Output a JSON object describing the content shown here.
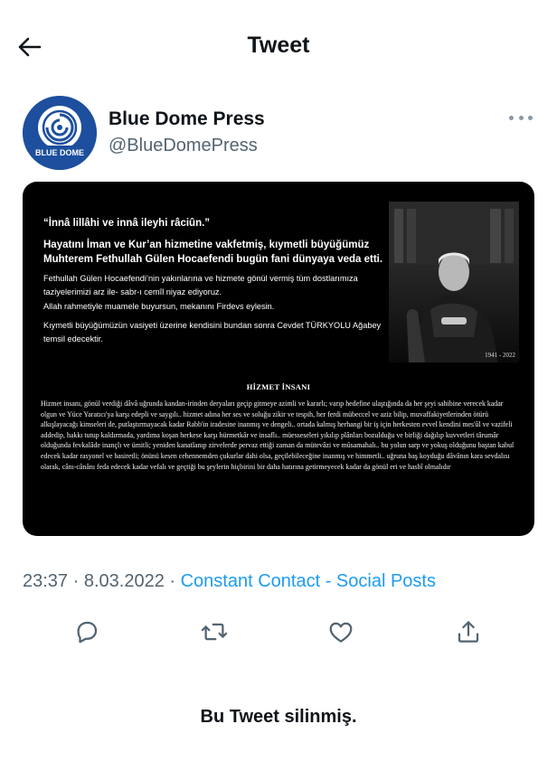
{
  "header": {
    "title": "Tweet"
  },
  "author": {
    "name": "Blue Dome Press",
    "handle": "@BlueDomePress",
    "avatar_text": "BLUE DOME",
    "avatar_color": "#1d4f9e"
  },
  "media": {
    "quote": "“İnnâ lillâhi ve innâ ileyhi râciûn.”",
    "p1": "Hayatını İman ve Kur’an hizmetine vakfetmiş, kıymetli büyüğümüz Muhterem Fethullah Gülen Hocaefendi bugün fani dünyaya veda etti.",
    "p2": "Fethullah Gülen Hocaefendi’nin yakınlarına ve hizmete gönül vermiş tüm dostlarımıza taziyelerimizi arz ile- sabr-ı cemîl niyaz ediyoruz.",
    "p3": "Allah rahmetiyle muamele buyursun, mekanını Firdevs eylesin.",
    "p4": "Kıymetli büyüğümüzün vasiyeti üzerine kendisini bundan sonra Cevdet TÜRKYOLU Ağabey temsil edecektir.",
    "years": "1941 - 2022",
    "heading": "HİZMET İNSANI",
    "body": "Hizmet insanı, gönül verdiği dâvâ uğrunda kandan-irinden deryaları geçip gitmeye azimli ve kararlı; varıp hedefine ulaştığında da her şeyi sahibine verecek kadar olgun ve Yüce Yaratıcı'ya karşı edepli ve saygılı.. hizmet adına her ses ve soluğu zikir ve tespih, her ferdi mübeccel ve aziz bilip, muvaffakiyetlerinden ötürü alkışlayacağı kimseleri de, putlaştırmayacak kadar Rabb'in iradesine inanmış ve dengeli.. ortada kalmış herhangi bir iş için herkesten evvel kendini mes'ûl ve vazifeli addedip, hakkı tutup kaldırmada, yardıma koşan herkese karşı hürmetkâr ve insaflı.. müesseseleri yıkılıp plânları bozulduğu ve birliği dağılıp kuvvetleri târumâr olduğunda fevkalâde inançlı ve ümitli; yeniden kanatlanıp zirvelerde pervaz ettiği zaman da mütevâzi ve mûsamahalı.. bu yolun sarp ve yokuş olduğunu baştan kabul edecek kadar rasyonel ve basiretli; önünü kesen cehennemden çukurlar dahi olsa, geçilebileceğine inanmış ve himmetli.. uğruna baş koyduğu dâvânın kara sevdalısı olarak, cânı-cânânı feda edecek kadar vefalı ve geçtiği bu şeylerin hiçbirini bir daha hatırına getirmeyecek kadar da gönül eri ve hasbî olmalıdır"
  },
  "meta": {
    "time": "23:37",
    "separator1": " · ",
    "date": "8.03.2022",
    "separator2": " · ",
    "source": "Constant Contact - Social Posts"
  },
  "actions": {
    "icons": [
      "reply-icon",
      "retweet-icon",
      "like-icon",
      "share-icon"
    ]
  },
  "status": {
    "deleted_text": "Bu Tweet silinmiş."
  },
  "colors": {
    "link": "#1d9bf0",
    "secondary_text": "#536471",
    "primary_text": "#0f1419",
    "media_background": "#000000"
  }
}
